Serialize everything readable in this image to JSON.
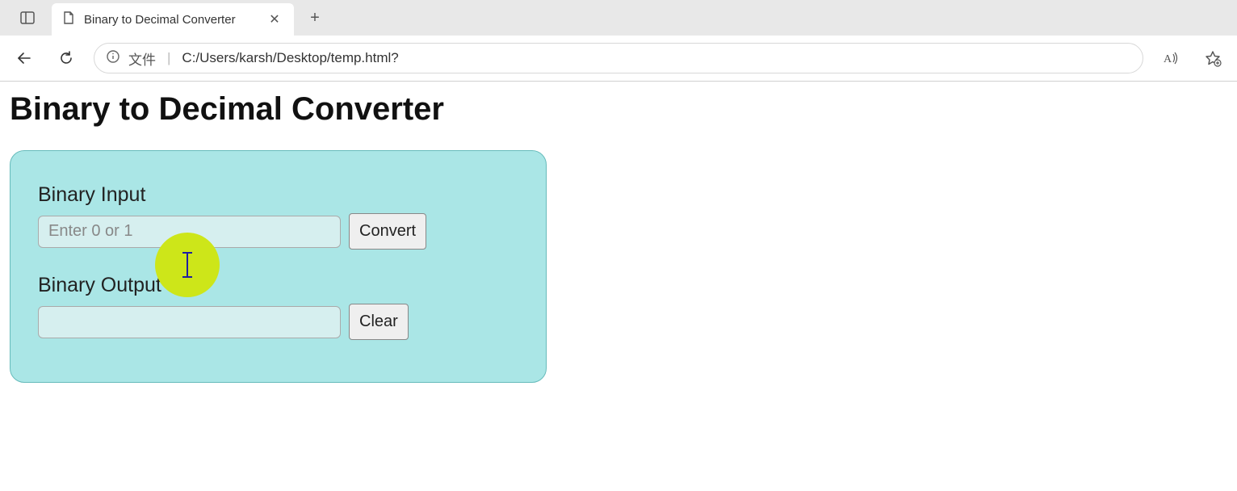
{
  "browser": {
    "tab_title": "Binary to Decimal Converter",
    "address_label": "文件",
    "url": "C:/Users/karsh/Desktop/temp.html?"
  },
  "page": {
    "heading": "Binary to Decimal Converter",
    "input_label": "Binary Input",
    "input_placeholder": "Enter 0 or 1",
    "input_value": "",
    "convert_button": "Convert",
    "output_label": "Binary Output",
    "output_value": "",
    "clear_button": "Clear"
  }
}
